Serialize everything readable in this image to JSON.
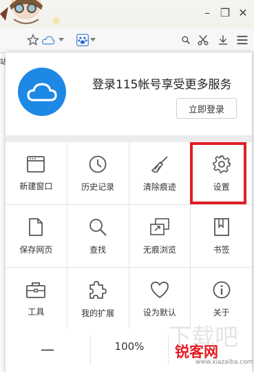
{
  "login": {
    "title": "登录115帐号享受更多服务",
    "button": "立即登录"
  },
  "menu_items": [
    {
      "label": "新建窗口",
      "icon": "new-window-icon"
    },
    {
      "label": "历史记录",
      "icon": "history-clock-icon"
    },
    {
      "label": "清除痕迹",
      "icon": "broom-icon"
    },
    {
      "label": "设置",
      "icon": "gear-icon"
    },
    {
      "label": "保存网页",
      "icon": "save-page-icon"
    },
    {
      "label": "查找",
      "icon": "search-icon"
    },
    {
      "label": "无痕浏览",
      "icon": "incognito-window-icon"
    },
    {
      "label": "书签",
      "icon": "bookmark-icon"
    },
    {
      "label": "工具",
      "icon": "toolbox-icon"
    },
    {
      "label": "我的扩展",
      "icon": "puzzle-icon"
    },
    {
      "label": "设为默认",
      "icon": "heart-icon"
    },
    {
      "label": "关于",
      "icon": "info-icon"
    }
  ],
  "zoom": {
    "minus": "—",
    "value": "100%"
  },
  "highlighted_item": "设置",
  "left_fragment": "站",
  "watermark": {
    "brand": "锐客网",
    "url": "www.xiazaiba.com"
  },
  "colors": {
    "accent_blue": "#1e88e5",
    "highlight_red": "#e11d24",
    "icon_gray": "#555555"
  }
}
